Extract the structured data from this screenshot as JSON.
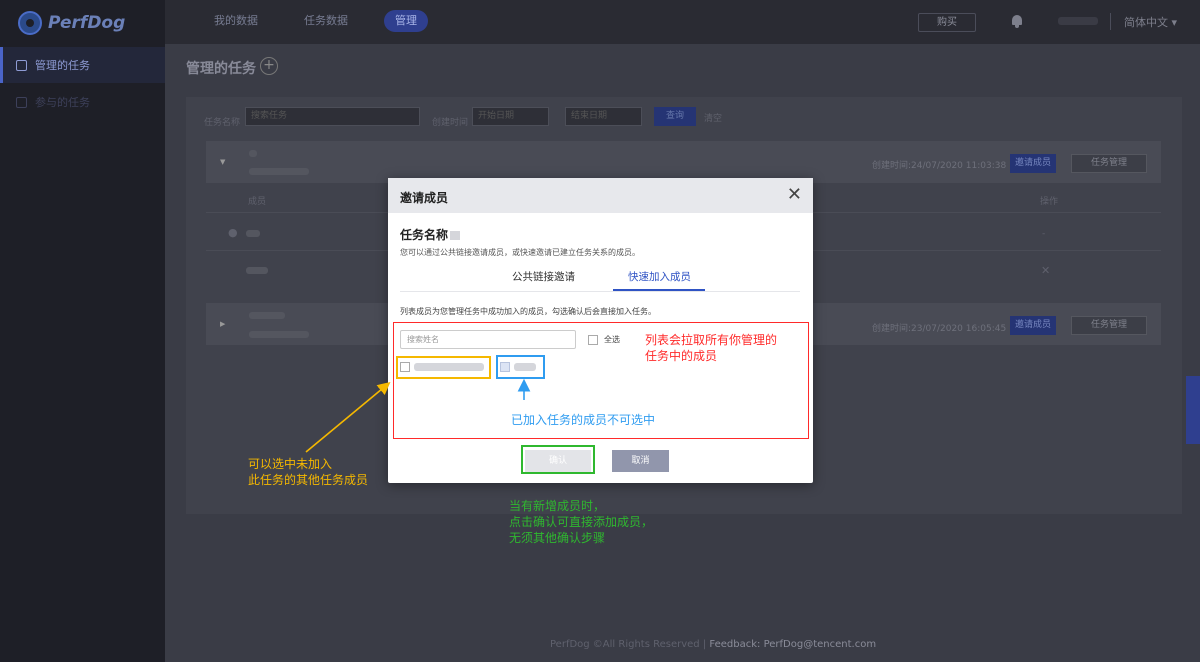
{
  "brand": {
    "name": "PerfDog"
  },
  "sidebar": {
    "items": [
      {
        "label": "管理的任务",
        "active": true
      },
      {
        "label": "参与的任务",
        "active": false
      }
    ]
  },
  "topbar": {
    "nav": [
      {
        "label": "我的数据"
      },
      {
        "label": "任务数据"
      },
      {
        "label": "管理",
        "active": true
      }
    ],
    "button_label": "购买",
    "language": "简体中文 ▾"
  },
  "page": {
    "title": "管理的任务",
    "add_symbol": "+",
    "filters": {
      "task_name_label": "任务名称",
      "task_name_placeholder": "搜索任务",
      "created_label": "创建时间",
      "start_placeholder": "开始日期",
      "end_placeholder": "结束日期",
      "search_button": "查询",
      "reset_label": "清空"
    },
    "task_rows": [
      {
        "created_time": "创建时间:24/07/2020 11:03:38",
        "primary_button": "邀请成员",
        "secondary_button": "任务管理",
        "members_header": "成员",
        "operation_header": "操作"
      },
      {
        "created_time": "创建时间:23/07/2020 16:05:45",
        "primary_button": "邀请成员",
        "secondary_button": "任务管理"
      }
    ]
  },
  "footer": {
    "copyright": "PerfDog ©All Rights Reserved",
    "feedback": "Feedback: PerfDog@tencent.com"
  },
  "modal": {
    "title": "邀请成员",
    "close_symbol": "✕",
    "task_name_label": "任务名称",
    "description": "您可以通过公共链接邀请成员，或快速邀请已建立任务关系的成员。",
    "tabs": [
      {
        "label": "公共链接邀请",
        "active": false
      },
      {
        "label": "快速加入成员",
        "active": true
      }
    ],
    "list_hint": "列表成员为您管理任务中成功加入的成员，勾选确认后会直接加入任务。",
    "search_placeholder": "搜索姓名",
    "select_all_label": "全选",
    "confirm_label": "确认",
    "cancel_label": "取消"
  },
  "annotations": {
    "red": {
      "text_line1": "列表会拉取所有你管理的",
      "text_line2": "任务中的成员",
      "color": "#ff2a2a"
    },
    "blue": {
      "text": "已加入任务的成员不可选中",
      "color": "#2f9cf0"
    },
    "orange": {
      "text_line1": "可以选中未加入",
      "text_line2": "此任务的其他任务成员",
      "color": "#f5b800"
    },
    "green": {
      "text_line1": "当有新增成员时，",
      "text_line2": "点击确认可直接添加成员，",
      "text_line3": "无须其他确认步骤",
      "color": "#2fb82f"
    }
  }
}
